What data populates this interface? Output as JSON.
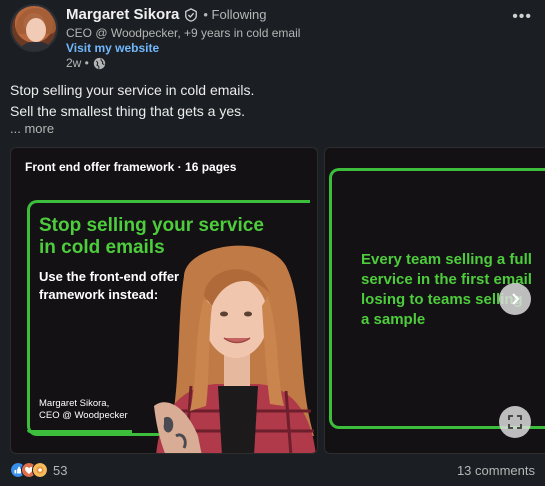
{
  "author": {
    "name": "Margaret Sikora",
    "following_label": "• Following",
    "headline": "CEO @ Woodpecker, +9 years in cold email",
    "website_label": "Visit my website",
    "time": "2w •"
  },
  "post": {
    "line1": "Stop selling your service in cold emails.",
    "line2": "Sell the smallest thing that gets a yes.",
    "see_more": "... more"
  },
  "document": {
    "title": "Front end offer framework · 16 pages",
    "slide1": {
      "headline_line1": "Stop selling your service",
      "headline_line2": "in cold emails",
      "sub_line1": "Use the front-end offer",
      "sub_line2": "framework instead:",
      "signature_line1": "Margaret Sikora,",
      "signature_line2": "CEO @ Woodpecker"
    },
    "slide2": {
      "line1": "Every team selling a full",
      "line2": "service in the first email",
      "line3": "losing to teams selling",
      "line4": "a sample"
    }
  },
  "social": {
    "reaction_count": "53",
    "comments": "13 comments"
  },
  "colors": {
    "accent_green": "#4dcc3c",
    "link_blue": "#71b7fb",
    "background": "#1b1f23"
  },
  "icons": [
    "verified-icon",
    "globe-icon",
    "more-menu-icon",
    "chevron-right-icon",
    "fullscreen-icon",
    "like-reaction-icon",
    "love-reaction-icon",
    "support-reaction-icon"
  ]
}
